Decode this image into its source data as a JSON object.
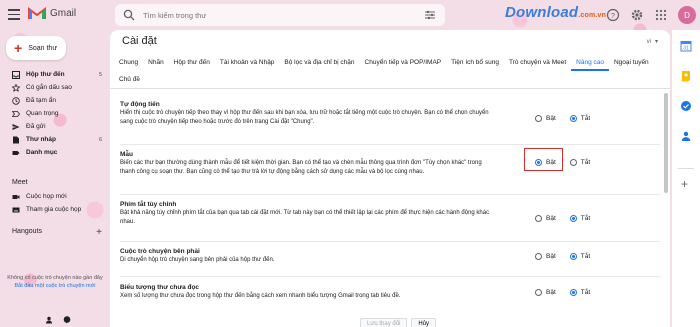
{
  "app": {
    "name": "Gmail"
  },
  "search": {
    "placeholder": "Tìm kiếm trong thư"
  },
  "watermark": {
    "text": "Download",
    "suffix": ".com.vn"
  },
  "account": {
    "avatar_letter": "D",
    "avatar_color": "#d86c9d"
  },
  "sidebar": {
    "compose_label": "Soạn thư",
    "items": [
      {
        "label": "Hộp thư đến",
        "count": "5",
        "bold": true,
        "icon": "inbox-icon"
      },
      {
        "label": "Có gắn dấu sao",
        "count": "",
        "bold": false,
        "icon": "star-icon"
      },
      {
        "label": "Đã tạm ẩn",
        "count": "",
        "bold": false,
        "icon": "clock-icon"
      },
      {
        "label": "Quan trọng",
        "count": "",
        "bold": false,
        "icon": "important-icon"
      },
      {
        "label": "Đã gửi",
        "count": "",
        "bold": false,
        "icon": "send-icon"
      },
      {
        "label": "Thư nháp",
        "count": "6",
        "bold": true,
        "icon": "draft-icon"
      },
      {
        "label": "Danh mục",
        "count": "",
        "bold": true,
        "icon": "label-icon"
      }
    ],
    "meet_title": "Meet",
    "meet_items": [
      {
        "label": "Cuộc họp mới",
        "icon": "video-icon"
      },
      {
        "label": "Tham gia cuộc họp",
        "icon": "keyboard-icon"
      }
    ],
    "hangouts_title": "Hangouts",
    "no_chats": "Không có cuộc trò chuyện nào gần đây",
    "start_chat": "Bắt đầu một cuộc trò chuyện mới"
  },
  "main": {
    "title": "Cài đặt",
    "lang": "vi",
    "tabs": [
      {
        "label": "Chung",
        "active": false
      },
      {
        "label": "Nhãn",
        "active": false
      },
      {
        "label": "Hộp thư đến",
        "active": false
      },
      {
        "label": "Tài khoản và Nhập",
        "active": false
      },
      {
        "label": "Bộ lọc và địa chỉ bị chặn",
        "active": false
      },
      {
        "label": "Chuyển tiếp và POP/IMAP",
        "active": false
      },
      {
        "label": "Tiện ích bổ sung",
        "active": false
      },
      {
        "label": "Trò chuyện và Meet",
        "active": false
      },
      {
        "label": "Nâng cao",
        "active": true
      },
      {
        "label": "Ngoại tuyến",
        "active": false
      },
      {
        "label": "Chủ đề",
        "active": false
      }
    ],
    "settings": [
      {
        "title": "Tự động tiến",
        "desc": "Hiển thị cuộc trò chuyện tiếp theo thay vì hộp thư đến sau khi bạn xóa, lưu trữ hoặc tắt tiếng một cuộc trò chuyện. Bạn có thể chọn chuyển sang cuộc trò chuyện tiếp theo hoặc trước đó trên trang Cài đặt \"Chung\".",
        "on_label": "Bật",
        "off_label": "Tắt",
        "selected": "off"
      },
      {
        "title": "Mẫu",
        "desc": "Biến các thư bạn thường dùng thành mẫu để tiết kiệm thời gian. Bạn có thể tạo và chèn mẫu thông qua trình đơn \"Tùy chọn khác\" trong thanh công cụ soạn thư. Bạn cũng có thể tạo thư trả lời tự động bằng cách sử dụng các mẫu và bộ lọc cùng nhau.",
        "on_label": "Bật",
        "off_label": "Tắt",
        "selected": "on"
      },
      {
        "title": "Phím tắt tùy chỉnh",
        "desc": "Bật khả năng tùy chỉnh phím tắt của bạn qua tab cài đặt mới. Từ tab này bạn có thể thiết lập lại các phím để thực hiện các hành động khác nhau.",
        "on_label": "Bật",
        "off_label": "Tắt",
        "selected": "off"
      },
      {
        "title": "Cuộc trò chuyện bên phải",
        "desc": "Di chuyển hộp trò chuyện sang bên phải của hộp thư đến.",
        "on_label": "Bật",
        "off_label": "Tắt",
        "selected": "off"
      },
      {
        "title": "Biểu tượng thư chưa đọc",
        "desc": "Xem số lượng thư chưa đọc trong hộp thư đến bằng cách xem nhanh biểu tượng Gmail trong tab tiêu đề.",
        "on_label": "Bật",
        "off_label": "Tắt",
        "selected": "off"
      }
    ],
    "save_label": "Lưu thay đổi",
    "cancel_label": "Hủy"
  },
  "colors": {
    "accent": "#1a73e8",
    "highlight": "#d32f2f",
    "brand_red": "#ea4335"
  }
}
